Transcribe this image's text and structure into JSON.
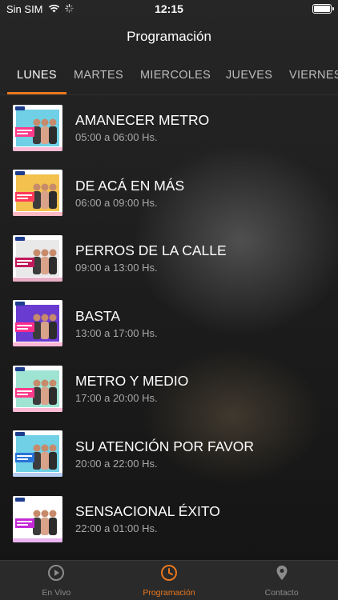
{
  "status_bar": {
    "carrier": "Sin SIM",
    "time": "12:15",
    "battery_level": 1.0
  },
  "header": {
    "title": "Programación"
  },
  "tabs": [
    {
      "label": "LUNES",
      "active": true
    },
    {
      "label": "MARTES",
      "active": false
    },
    {
      "label": "MIERCOLES",
      "active": false
    },
    {
      "label": "JUEVES",
      "active": false
    },
    {
      "label": "VIERNES",
      "active": false
    }
  ],
  "programs": [
    {
      "title": "AMANECER METRO",
      "time": "05:00 a 06:00 Hs.",
      "thumb_accent": "#ff3a8a",
      "thumb_bg": "#6fd0e6"
    },
    {
      "title": "DE ACÁ EN MÁS",
      "time": "06:00 a 09:00 Hs.",
      "thumb_accent": "#ff3a5a",
      "thumb_bg": "#f2c14e"
    },
    {
      "title": "PERROS DE LA CALLE",
      "time": "09:00 a 13:00 Hs.",
      "thumb_accent": "#c2185b",
      "thumb_bg": "#e9e9e9"
    },
    {
      "title": "BASTA",
      "time": "13:00 a 17:00 Hs.",
      "thumb_accent": "#ff2d8a",
      "thumb_bg": "#6a3bd1"
    },
    {
      "title": "METRO Y MEDIO",
      "time": "17:00 a 20:00 Hs.",
      "thumb_accent": "#ff3a8a",
      "thumb_bg": "#9fe3d3"
    },
    {
      "title": "SU ATENCIÓN POR FAVOR",
      "time": "20:00 a 22:00 Hs.",
      "thumb_accent": "#2a73d9",
      "thumb_bg": "#6fd0e6"
    },
    {
      "title": "SENSACIONAL ÉXITO",
      "time": "22:00 a 01:00 Hs.",
      "thumb_accent": "#c42ad8",
      "thumb_bg": "#ffffff"
    }
  ],
  "tabbar": [
    {
      "label": "En Vivo",
      "icon": "play-circle-icon",
      "active": false
    },
    {
      "label": "Programación",
      "icon": "clock-icon",
      "active": true
    },
    {
      "label": "Contacto",
      "icon": "location-pin-icon",
      "active": false
    }
  ],
  "colors": {
    "accent": "#e8771f",
    "inactive": "#8b8b8b"
  }
}
